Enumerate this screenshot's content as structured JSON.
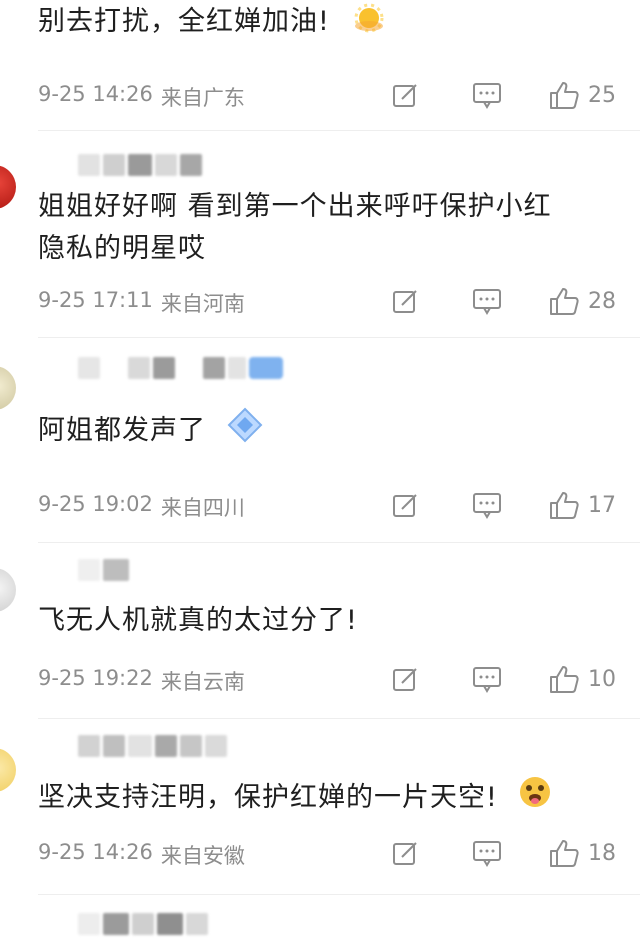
{
  "comments": [
    {
      "text_lines": [
        "别去打扰，全红婵加油!"
      ],
      "date": "9-25 14:26",
      "location": "来自广东",
      "likes": "25",
      "emoji": "sun"
    },
    {
      "text_lines": [
        "姐姐好好啊 看到第一个出来呼吁保护小红",
        "隐私的明星哎"
      ],
      "date": "9-25 17:11",
      "location": "来自河南",
      "likes": "28"
    },
    {
      "text_lines": [
        "阿姐都发声了"
      ],
      "date": "9-25 19:02",
      "location": "来自四川",
      "likes": "17",
      "emoji": "diamond"
    },
    {
      "text_lines": [
        "飞无人机就真的太过分了!"
      ],
      "date": "9-25 19:22",
      "location": "来自云南",
      "likes": "10"
    },
    {
      "text_lines": [
        "坚决支持汪明，保护红婵的一片天空!"
      ],
      "date": "9-25 14:26",
      "location": "来自安徽",
      "likes": "18",
      "emoji": "tongue-face"
    }
  ],
  "icons": {
    "repost": "repost-icon",
    "comment": "comment-icon",
    "like": "thumbs-up-icon"
  },
  "colors": {
    "meta": "#8d8d8d",
    "text": "#1f1f1f"
  }
}
